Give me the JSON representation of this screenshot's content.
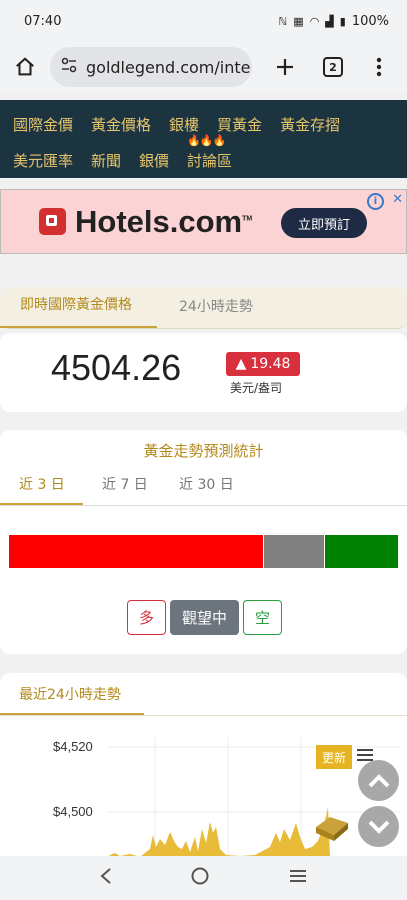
{
  "status": {
    "time": "07:40",
    "battery": "100%"
  },
  "browser": {
    "url": "goldlegend.com/interi",
    "tab_count": "2"
  },
  "nav": {
    "row1": [
      "國際金價",
      "黃金價格",
      "銀樓",
      "買黃金",
      "黃金存摺"
    ],
    "row2": [
      "美元匯率",
      "新聞",
      "銀價",
      "討論區"
    ]
  },
  "ad": {
    "brand": "Hotels.com",
    "cta": "立即預訂"
  },
  "price_tabs": {
    "active": "即時國際黃金價格",
    "inactive": "24小時走勢"
  },
  "price": {
    "value": "4504.26",
    "change": "19.48",
    "unit": "美元/盎司"
  },
  "forecast": {
    "title": "黃金走勢預測統計",
    "tabs": [
      "近 3 日",
      "近 7 日",
      "近 30 日"
    ],
    "distribution": {
      "long": 0.66,
      "wait": 0.16,
      "short": 0.19
    },
    "colors": {
      "long": "#ff0000",
      "wait": "#808080",
      "short": "#008000"
    },
    "buttons": {
      "long": "多",
      "wait": "觀望中",
      "short": "空"
    }
  },
  "trend": {
    "title": "最近24小時走勢",
    "update": "更新"
  },
  "chart_data": {
    "type": "area",
    "yticks": [
      "$4,520",
      "$4,500"
    ],
    "ylim": [
      4480,
      4525
    ],
    "grid": true
  }
}
